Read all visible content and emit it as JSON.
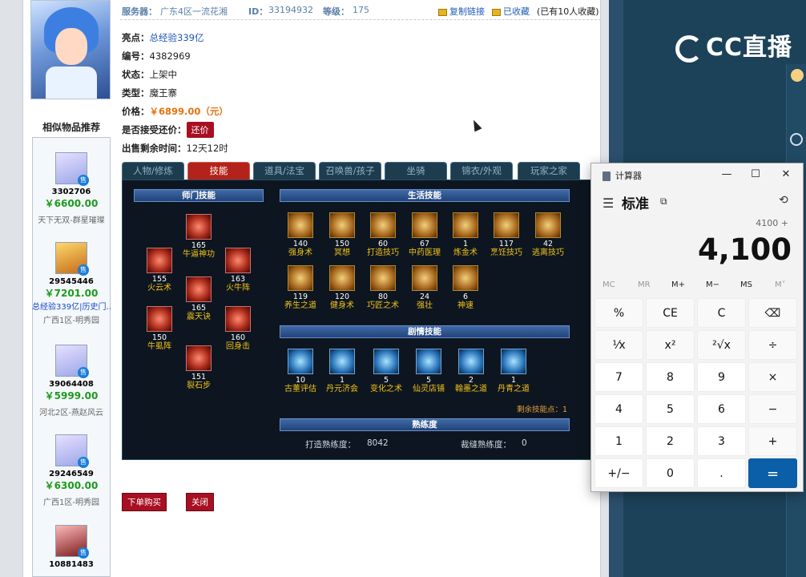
{
  "header": {
    "server_label": "服务器：",
    "server_value": "广东4区一流花湘",
    "id_label": "ID：",
    "id_value": "33194932",
    "level_label": "等级：",
    "level_value": "175",
    "copy_link": "复制链接",
    "favorited": "已收藏",
    "fav_count": "(已有10人收藏)"
  },
  "info": {
    "highlight_label": "亮点：",
    "highlight_value": "总经验339亿",
    "number_label": "编号：",
    "number_value": "4382969",
    "status_label": "状态：",
    "status_value": "上架中",
    "type_label": "类型：",
    "type_value": "魔王寨",
    "price_label": "价格：",
    "price_value": "￥6899.00（元）",
    "bargain_label": "是否接受还价：",
    "bargain_button": "还价",
    "time_label": "出售剩余时间：",
    "time_value": "12天12时"
  },
  "similar": {
    "title": "相似物品推荐",
    "items": [
      {
        "id": "3302706",
        "price": "￥6600.00",
        "server": "天下无双-群星璀璨",
        "note": ""
      },
      {
        "id": "29545446",
        "price": "￥7201.00",
        "server": "广西1区-明秀园",
        "note": "总经验339亿|历史门…"
      },
      {
        "id": "39064408",
        "price": "￥5999.00",
        "server": "河北2区-燕赵风云",
        "note": ""
      },
      {
        "id": "29246549",
        "price": "￥6300.00",
        "server": "广西1区-明秀园",
        "note": ""
      },
      {
        "id": "10881483",
        "price": "",
        "server": "",
        "note": ""
      }
    ],
    "sale_tag": "售"
  },
  "tabs": [
    "人物/修炼",
    "技能",
    "道具/法宝",
    "召唤兽/孩子",
    "坐骑",
    "锦衣/外观",
    "玩家之家"
  ],
  "skills": {
    "school_header": "师门技能",
    "life_header": "生活技能",
    "plot_header": "剧情技能",
    "prof_header": "熟练度",
    "school": [
      {
        "level": "165",
        "name": "牛逼神功"
      },
      {
        "level": "155",
        "name": "火云术"
      },
      {
        "level": "163",
        "name": "火牛阵"
      },
      {
        "level": "165",
        "name": "震天诀"
      },
      {
        "level": "150",
        "name": "牛虱阵"
      },
      {
        "level": "160",
        "name": "回身击"
      },
      {
        "level": "151",
        "name": "裂石步"
      }
    ],
    "life": [
      {
        "level": "140",
        "name": "强身术"
      },
      {
        "level": "150",
        "name": "冥想"
      },
      {
        "level": "60",
        "name": "打造技巧"
      },
      {
        "level": "67",
        "name": "中药医理"
      },
      {
        "level": "1",
        "name": "炼金术"
      },
      {
        "level": "117",
        "name": "烹饪技巧"
      },
      {
        "level": "42",
        "name": "逃离技巧"
      },
      {
        "level": "119",
        "name": "养生之道"
      },
      {
        "level": "120",
        "name": "健身术"
      },
      {
        "level": "80",
        "name": "巧匠之术"
      },
      {
        "level": "24",
        "name": "强壮"
      },
      {
        "level": "6",
        "name": "神速"
      }
    ],
    "plot": [
      {
        "level": "10",
        "name": "古董评估"
      },
      {
        "level": "1",
        "name": "丹元济会"
      },
      {
        "level": "5",
        "name": "变化之术"
      },
      {
        "level": "5",
        "name": "仙灵店铺"
      },
      {
        "level": "2",
        "name": "翰墨之道"
      },
      {
        "level": "1",
        "name": "丹青之道"
      }
    ],
    "remaining": "剩余技能点：1",
    "forge_label": "打造熟练度：",
    "forge_value": "8042",
    "tailor_label": "裁缝熟练度：",
    "tailor_value": "0"
  },
  "actions": {
    "buy": "下单购买",
    "close": "关闭"
  },
  "cc_logo": "CC直播",
  "calculator": {
    "title": "计算器",
    "mode": "标准",
    "expression": "4100 +",
    "display": "4,100",
    "memory": [
      "MC",
      "MR",
      "M+",
      "M−",
      "MS",
      "M˅"
    ],
    "keys": [
      [
        "%",
        "CE",
        "C",
        "⌫"
      ],
      [
        "¹⁄x",
        "x²",
        "²√x",
        "÷"
      ],
      [
        "7",
        "8",
        "9",
        "×"
      ],
      [
        "4",
        "5",
        "6",
        "−"
      ],
      [
        "1",
        "2",
        "3",
        "+"
      ],
      [
        "+/−",
        "0",
        ".",
        "="
      ]
    ]
  }
}
